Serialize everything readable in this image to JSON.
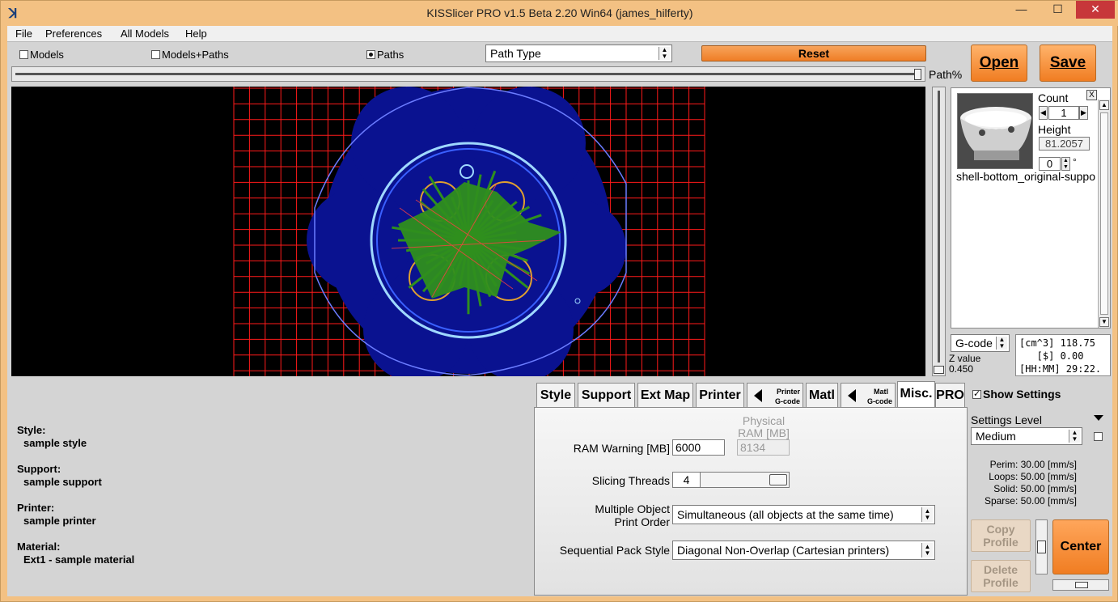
{
  "window": {
    "title": "KISSlicer PRO v1.5 Beta 2.20 Win64 (james_hilferty)",
    "min_glyph": "—",
    "max_glyph": "☐",
    "close_glyph": "✕",
    "app_icon_glyph": "ꓘ"
  },
  "menu": [
    "File",
    "Preferences",
    "All Models",
    "Help"
  ],
  "view_modes": {
    "models_label": "Models",
    "models_paths_label": "Models+Paths",
    "paths_label": "Paths",
    "selected": "Paths"
  },
  "path_type": {
    "value": "Path Type"
  },
  "reset_label": "Reset",
  "open_label": "Open",
  "save_label": "Save",
  "path_slider": {
    "label": "Path%",
    "value_percent": 100
  },
  "models": {
    "count_label": "Count",
    "count_value": "1",
    "height_label": "Height",
    "height_value": "81.2057",
    "rotation_value": "0",
    "rotation_unit": "°",
    "name": "shell-bottom_original-suppo",
    "close_label": "X"
  },
  "z": {
    "label": "Z value",
    "value": "0.450"
  },
  "output_format": {
    "value": "G-code"
  },
  "stats": {
    "line1": "[cm^3] 118.75",
    "line2": "   [$] 0.00",
    "line3": "[HH:MM] 29:22."
  },
  "summary": {
    "style_label": "Style:",
    "style_value": "sample style",
    "support_label": "Support:",
    "support_value": "sample support",
    "printer_label": "Printer:",
    "printer_value": "sample printer",
    "material_label": "Material:",
    "material_value": "Ext1 - sample material"
  },
  "tabs": {
    "style": "Style",
    "support": "Support",
    "ext_map": "Ext Map",
    "printer": "Printer",
    "printer_gcode_top": "Printer",
    "printer_gcode_bottom": "G-code",
    "matl": "Matl",
    "matl_gcode_top": "Matl",
    "matl_gcode_bottom": "G-code",
    "misc": "Misc.",
    "pro": "PRO",
    "active": "Misc."
  },
  "misc": {
    "physical_ram_label_1": "Physical",
    "physical_ram_label_2": "RAM [MB]",
    "ram_warning_label": "RAM Warning [MB]",
    "ram_warning_value": "6000",
    "physical_ram_value": "8134",
    "slicing_threads_label": "Slicing Threads",
    "slicing_threads_value": "4",
    "print_order_label_1": "Multiple Object",
    "print_order_label_2": "Print Order",
    "print_order_value": "Simultaneous (all objects at the same time)",
    "pack_style_label": "Sequential Pack Style",
    "pack_style_value": "Diagonal Non-Overlap (Cartesian printers)"
  },
  "right_panel": {
    "show_settings_label": "Show Settings",
    "show_settings_checked": true,
    "settings_level_label": "Settings Level",
    "settings_level_value": "Medium",
    "speeds": {
      "perim": "Perim:  30.00 [mm/s]",
      "loops": "Loops:  50.00 [mm/s]",
      "solid": "Solid:  50.00 [mm/s]",
      "sparse": "Sparse: 50.00 [mm/s]"
    },
    "copy_profile_1": "Copy",
    "copy_profile_2": "Profile",
    "delete_profile_1": "Delete",
    "delete_profile_2": "Profile",
    "center_label": "Center"
  },
  "colors": {
    "accent_orange": "#f07d22",
    "bed_grid": "#ff1a1a",
    "raft_blue": "#0a1290",
    "infill_green": "#2f8f1e",
    "perimeter_cyan": "#9fd8ff"
  }
}
